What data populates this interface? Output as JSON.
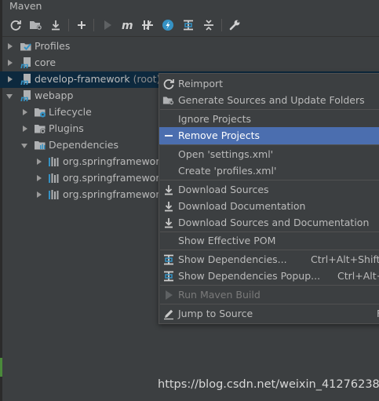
{
  "window": {
    "title": "Maven"
  },
  "toolbar": {
    "buttons": [
      {
        "icon": "refresh-icon"
      },
      {
        "icon": "generate-sources-icon"
      },
      {
        "icon": "download-icon"
      },
      {
        "icon": "add-icon"
      },
      {
        "icon": "run-icon"
      },
      {
        "icon": "execute-goal-icon"
      },
      {
        "icon": "toggle-offline-icon"
      },
      {
        "icon": "skip-tests-icon"
      },
      {
        "icon": "show-dependencies-icon"
      },
      {
        "icon": "collapse-all-icon"
      },
      {
        "icon": "settings-wrench-icon"
      }
    ]
  },
  "tree": {
    "items": [
      {
        "label": "Profiles",
        "expanded": false
      },
      {
        "label": "core",
        "expanded": false
      },
      {
        "label": "develop-framework",
        "suffix": "(root)",
        "expanded": false,
        "selected": true
      },
      {
        "label": "webapp",
        "expanded": true
      },
      {
        "label": "Lifecycle",
        "expanded": false
      },
      {
        "label": "Plugins",
        "expanded": false
      },
      {
        "label": "Dependencies",
        "expanded": true
      },
      {
        "label": "org.springframework",
        "expanded": false
      },
      {
        "label": "org.springframework",
        "expanded": false
      },
      {
        "label": "org.springframework",
        "expanded": false
      }
    ]
  },
  "context_menu": {
    "items": [
      {
        "label": "Reimport",
        "icon": "reimport-icon"
      },
      {
        "label": "Generate Sources and Update Folders",
        "icon": "generate-sources-icon"
      },
      {
        "label": "Ignore Projects"
      },
      {
        "label": "Remove Projects",
        "icon": "minus-icon",
        "active": true
      },
      {
        "label": "Open 'settings.xml'"
      },
      {
        "label": "Create 'profiles.xml'"
      },
      {
        "label": "Download Sources",
        "icon": "download-icon"
      },
      {
        "label": "Download Documentation",
        "icon": "download-icon"
      },
      {
        "label": "Download Sources and Documentation",
        "icon": "download-icon"
      },
      {
        "label": "Show Effective POM"
      },
      {
        "label": "Show Dependencies...",
        "shortcut": "Ctrl+Alt+Shift+",
        "icon": "dependencies-icon"
      },
      {
        "label": "Show Dependencies Popup...",
        "shortcut": "Ctrl+Alt+",
        "icon": "dependencies-icon"
      },
      {
        "label": "Run Maven Build",
        "icon": "run-icon",
        "disabled": true
      },
      {
        "label": "Jump to Source",
        "shortcut": "F",
        "icon": "edit-pencil-icon"
      }
    ]
  },
  "watermark": {
    "text": "https://blog.csdn.net/weixin_41276238"
  },
  "colors": {
    "background": "#3c3f41",
    "selection": "#0d293e",
    "menu_active": "#4b6eaf",
    "text": "#bbbbbb",
    "icon_blue": "#3592c4"
  }
}
